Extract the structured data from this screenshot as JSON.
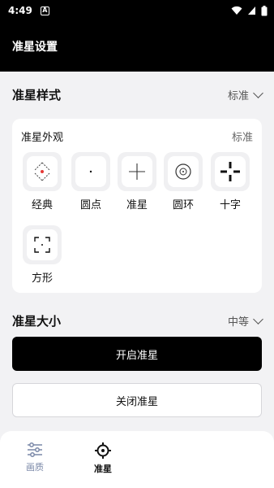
{
  "status_bar": {
    "time": "4:49",
    "notif_letter": "A"
  },
  "app_bar": {
    "title": "准星设置"
  },
  "style_section": {
    "title": "准星样式",
    "value": "标准"
  },
  "appearance_card": {
    "title": "准星外观",
    "subtitle": "标准",
    "styles": [
      {
        "label": "经典",
        "icon": "classic-crosshair-icon"
      },
      {
        "label": "圆点",
        "icon": "dot-icon"
      },
      {
        "label": "准星",
        "icon": "plus-crosshair-icon"
      },
      {
        "label": "圆环",
        "icon": "ring-icon"
      },
      {
        "label": "十字",
        "icon": "cross-icon"
      },
      {
        "label": "方形",
        "icon": "square-bracket-icon"
      }
    ]
  },
  "size_section": {
    "title": "准星大小",
    "value": "中等"
  },
  "buttons": {
    "enable": "开启准星",
    "disable": "关闭准星"
  },
  "bottom_nav": {
    "items": [
      {
        "label": "画质",
        "icon": "sliders-icon",
        "active": false
      },
      {
        "label": "准星",
        "icon": "crosshair-icon",
        "active": true
      }
    ]
  },
  "colors": {
    "accent": "#000000",
    "tile_bg": "#f0f0f2",
    "inactive_nav": "#7a88a8"
  }
}
